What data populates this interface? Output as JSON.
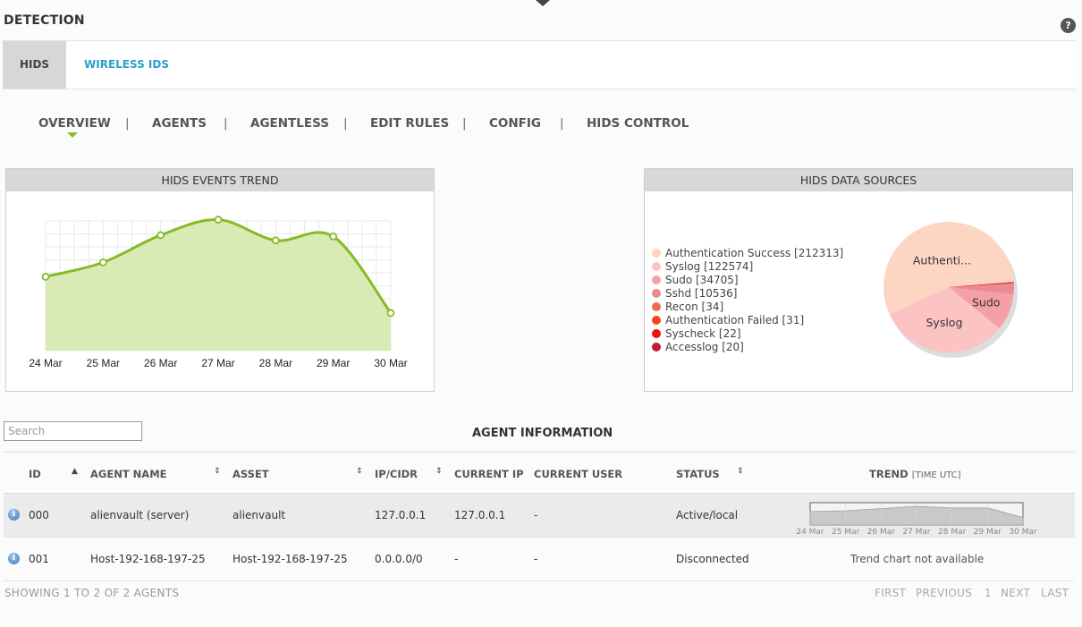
{
  "page": {
    "title": "DETECTION",
    "help_label": "?"
  },
  "tabs": [
    {
      "label": "HIDS",
      "active": true
    },
    {
      "label": "WIRELESS IDS",
      "active": false
    }
  ],
  "subnav": {
    "items": [
      "OVERVIEW",
      "AGENTS",
      "AGENTLESS",
      "EDIT RULES",
      "CONFIG",
      "HIDS CONTROL"
    ],
    "separator": "|",
    "active": "OVERVIEW"
  },
  "events_trend": {
    "title": "HIDS EVENTS TREND",
    "chart_data": {
      "type": "area",
      "categories": [
        "24 Mar",
        "25 Mar",
        "26 Mar",
        "27 Mar",
        "28 Mar",
        "29 Mar",
        "30 Mar"
      ],
      "values": [
        57,
        68,
        89,
        101,
        85,
        88,
        29
      ],
      "ylim": [
        0,
        100
      ],
      "grid": true,
      "color": "#86bb25",
      "fill": "#d8ebb4"
    }
  },
  "data_sources": {
    "title": "HIDS DATA SOURCES",
    "chart_data": {
      "type": "pie",
      "slices": [
        {
          "label": "Authentication Success [212313]",
          "short": "Authenti...",
          "value": 212313,
          "color": "#fdd5c3"
        },
        {
          "label": "Syslog [122574]",
          "short": "Syslog",
          "value": 122574,
          "color": "#fcc3c3"
        },
        {
          "label": "Sudo [34705]",
          "short": "Sudo",
          "value": 34705,
          "color": "#f5a0a5"
        },
        {
          "label": "Sshd [10536]",
          "short": "",
          "value": 10536,
          "color": "#ea8a92"
        },
        {
          "label": "Recon [34]",
          "short": "",
          "value": 34,
          "color": "#f0684f"
        },
        {
          "label": "Authentication Failed [31]",
          "short": "",
          "value": 31,
          "color": "#f14a12"
        },
        {
          "label": "Syscheck [22]",
          "short": "",
          "value": 22,
          "color": "#ea1212"
        },
        {
          "label": "Accesslog [20]",
          "short": "",
          "value": 20,
          "color": "#c21a3a"
        }
      ]
    }
  },
  "agents": {
    "search_placeholder": "Search",
    "title": "AGENT INFORMATION",
    "columns": [
      "ID",
      "AGENT NAME",
      "ASSET",
      "IP/CIDR",
      "CURRENT IP",
      "CURRENT USER",
      "STATUS",
      "TREND"
    ],
    "trend_suffix": "[TIME UTC]",
    "sort_asc_icon": "▲",
    "sort_both_icon": "⇕",
    "rows": [
      {
        "id": "000",
        "name": "alienvault (server)",
        "asset": "alienvault",
        "ip_cidr": "127.0.0.1",
        "current_ip": "127.0.0.1",
        "current_user": "-",
        "status": "Active/local",
        "trend": [
          36,
          38,
          44,
          50,
          46,
          46,
          20
        ]
      },
      {
        "id": "001",
        "name": "Host-192-168-197-25",
        "asset": "Host-192-168-197-25",
        "ip_cidr": "0.0.0.0/0",
        "current_ip": "-",
        "current_user": "-",
        "status": "Disconnected",
        "trend_message": "Trend chart not available"
      }
    ],
    "trend_dates": [
      "24 Mar",
      "25 Mar",
      "26 Mar",
      "27 Mar",
      "28 Mar",
      "29 Mar",
      "30 Mar"
    ],
    "footer": "SHOWING 1 TO 2 OF 2 AGENTS",
    "pager": {
      "first": "FIRST",
      "previous": "PREVIOUS",
      "page": "1",
      "next": "NEXT",
      "last": "LAST"
    }
  }
}
